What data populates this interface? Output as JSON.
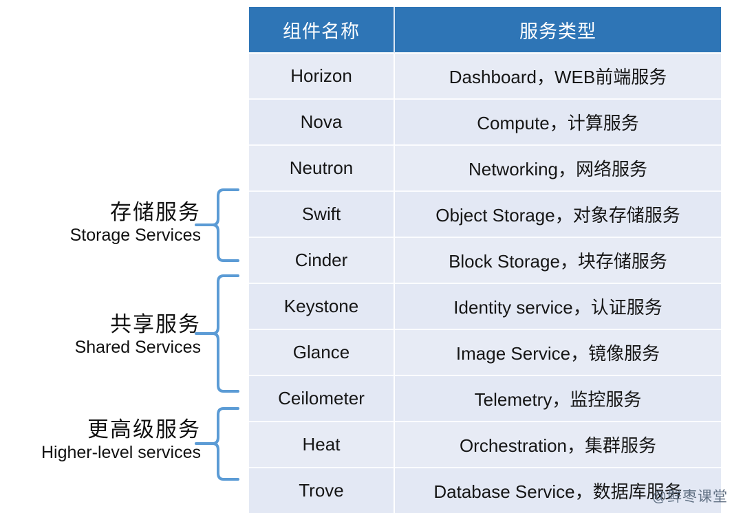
{
  "table": {
    "columns": [
      "组件名称",
      "服务类型"
    ],
    "rows": [
      {
        "name": "Horizon",
        "type": "Dashboard，WEB前端服务"
      },
      {
        "name": "Nova",
        "type": "Compute，计算服务"
      },
      {
        "name": "Neutron",
        "type": "Networking，网络服务"
      },
      {
        "name": "Swift",
        "type": "Object Storage，对象存储服务"
      },
      {
        "name": "Cinder",
        "type": "Block Storage，块存储服务"
      },
      {
        "name": "Keystone",
        "type": "Identity service，认证服务"
      },
      {
        "name": "Glance",
        "type": "Image Service，镜像服务"
      },
      {
        "name": "Ceilometer",
        "type": "Telemetry，监控服务"
      },
      {
        "name": "Heat",
        "type": "Orchestration，集群服务"
      },
      {
        "name": "Trove",
        "type": "Database Service，数据库服务"
      }
    ]
  },
  "groups": [
    {
      "cn": "存储服务",
      "en": "Storage Services",
      "covers": [
        "Swift",
        "Cinder"
      ]
    },
    {
      "cn": "共享服务",
      "en": "Shared Services",
      "covers": [
        "Keystone",
        "Glance",
        "Ceilometer"
      ]
    },
    {
      "cn": "更高级服务",
      "en": "Higher-level services",
      "covers": [
        "Heat",
        "Trove"
      ]
    }
  ],
  "watermark": "@鲜枣课堂",
  "colors": {
    "header_blue": "#2e75b6",
    "row_bg": "#e7ebf5",
    "row_bg_alt": "#e3e8f4",
    "brace_blue": "#5b9bd5",
    "watermark": "#5a6a7d"
  }
}
